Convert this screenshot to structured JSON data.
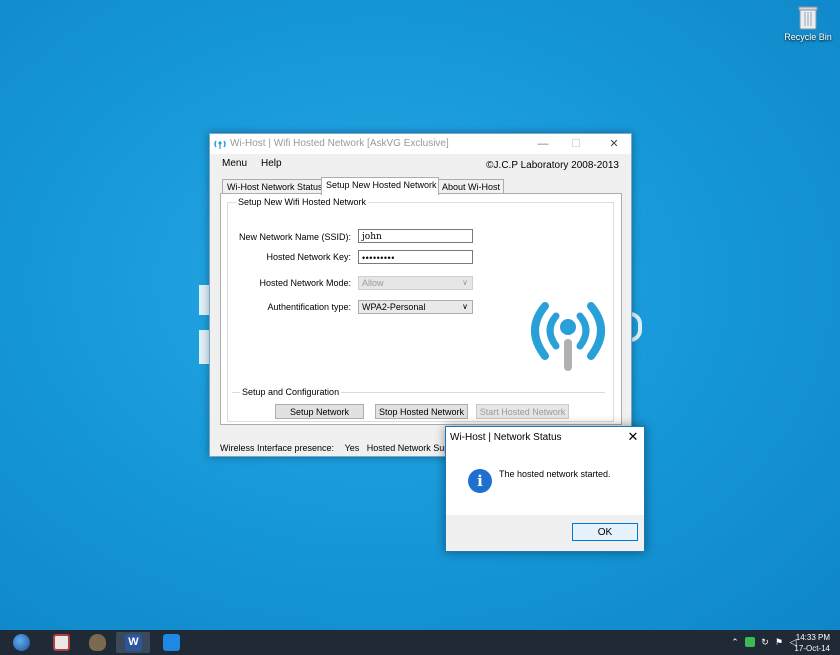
{
  "desktop": {
    "recycle_bin_label": "Recycle Bin"
  },
  "window": {
    "title": "Wi-Host | Wifi Hosted Network [AskVG Exclusive]",
    "menu": [
      "Menu",
      "Help"
    ],
    "copyright": "©J.C.P Laboratory 2008-2013",
    "tabs": [
      "Wi-Host Network Status",
      "Setup New Hosted Network",
      "About Wi-Host"
    ],
    "active_tab": "Setup New Hosted Network",
    "group_title": "Setup New Wifi Hosted Network",
    "fields": {
      "ssid_label": "New Network Name (SSID):",
      "ssid_value": "john",
      "key_label": "Hosted Network Key:",
      "key_value": "•••••••••",
      "mode_label": "Hosted Network Mode:",
      "mode_value": "Allow",
      "auth_label": "Authentification type:",
      "auth_value": "WPA2-Personal"
    },
    "setup_group_title": "Setup and Configuration",
    "buttons": {
      "setup": "Setup Network",
      "stop": "Stop Hosted Network",
      "start": "Start Hosted Network"
    },
    "status": {
      "wireless_label": "Wireless Interface presence:",
      "wireless_value": "Yes",
      "hosted_support_label": "Hosted Network Suppo"
    },
    "logo_color": "#2aa0d8",
    "logo_stem_color": "#b0b0b0"
  },
  "dialog": {
    "title": "Wi-Host | Network Status",
    "icon": "info-icon",
    "message": "The hosted network started.",
    "ok_label": "OK"
  },
  "taskbar": {
    "apps": [
      "thunderbird-icon",
      "chat-icon",
      "gimp-icon",
      "word-icon",
      "remote-icon"
    ],
    "tray_icons": [
      "chevron-up-icon",
      "network-icon",
      "sync-icon",
      "flag-icon",
      "volume-icon"
    ],
    "time": "14:33 PM",
    "date": "17-Oct-14"
  }
}
